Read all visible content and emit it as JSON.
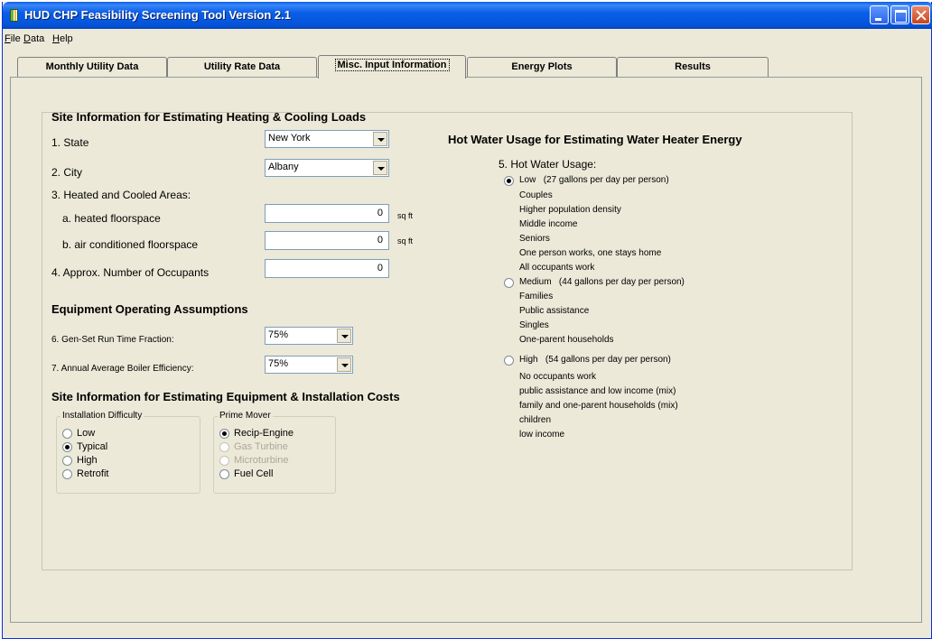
{
  "window": {
    "title": "HUD CHP Feasibility Screening Tool Version 2.1"
  },
  "menu": [
    {
      "key": "F",
      "rest": "ile"
    },
    {
      "key": "D",
      "rest": "ata"
    },
    {
      "key": "H",
      "rest": "elp"
    }
  ],
  "tabs": [
    "Monthly Utility Data",
    "Utility Rate Data",
    "Misc. Input Information",
    "Energy Plots",
    "Results"
  ],
  "active_tab": "Misc. Input Information",
  "site_loads": {
    "title": "Site Information for Estimating Heating & Cooling Loads",
    "state_label": "1. State",
    "state_value": "New York",
    "city_label": "2. City",
    "city_value": "Albany",
    "areas_label": "3. Heated and Cooled Areas:",
    "heated_label": "a. heated floorspace",
    "heated_value": "0",
    "heated_unit": "sq ft",
    "cooled_label": "b. air conditioned floorspace",
    "cooled_value": "0",
    "cooled_unit": "sq ft",
    "occupants_label": "4. Approx. Number of Occupants",
    "occupants_value": "0"
  },
  "equipment": {
    "title": "Equipment Operating Assumptions",
    "genset_label": "6. Gen-Set Run Time Fraction:",
    "genset_value": "75%",
    "boiler_label": "7. Annual Average Boiler Efficiency:",
    "boiler_value": "75%"
  },
  "costs": {
    "title": "Site Information for Estimating Equipment & Installation Costs",
    "difficulty": {
      "title": "Installation Difficulty",
      "options": [
        "Low",
        "Typical",
        "High",
        "Retrofit"
      ],
      "selected": "Typical"
    },
    "prime_mover": {
      "title": "Prime Mover",
      "options": [
        "Recip-Engine",
        "Gas Turbine",
        "Microturbine",
        "Fuel Cell"
      ],
      "disabled": [
        "Gas Turbine",
        "Microturbine"
      ],
      "selected": "Recip-Engine"
    }
  },
  "hot_water": {
    "title": "Hot Water Usage for Estimating Water Heater Energy",
    "usage_label": "5. Hot Water Usage:",
    "selected": "Low",
    "low": {
      "label": "Low",
      "desc": "(27 gallons per day per person)",
      "items": [
        "Couples",
        "Higher population density",
        "Middle income",
        "Seniors",
        "One person works, one stays home",
        "All occupants work"
      ]
    },
    "medium": {
      "label": "Medium",
      "desc": "(44 gallons per day per person)",
      "items": [
        "Families",
        "Public assistance",
        "Singles",
        "One-parent households"
      ]
    },
    "high": {
      "label": "High",
      "desc": "(54 gallons per day per person)",
      "items": [
        "No occupants work",
        "public assistance and low income (mix)",
        "family and one-parent households (mix)",
        "children",
        "low income"
      ]
    }
  }
}
